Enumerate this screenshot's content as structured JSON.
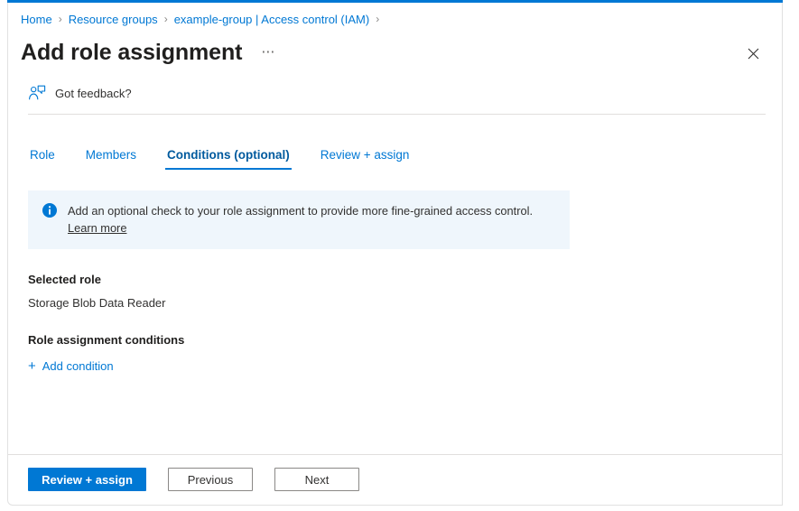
{
  "breadcrumb": {
    "items": [
      {
        "label": "Home"
      },
      {
        "label": "Resource groups"
      },
      {
        "label": "example-group | Access control (IAM)"
      }
    ],
    "separator": "›"
  },
  "header": {
    "title": "Add role assignment",
    "ellipsis": "⋯",
    "close_label": "Close"
  },
  "feedback": {
    "label": "Got feedback?",
    "icon": "person-feedback-icon"
  },
  "tabs": [
    {
      "label": "Role",
      "active": false
    },
    {
      "label": "Members",
      "active": false
    },
    {
      "label": "Conditions (optional)",
      "active": true
    },
    {
      "label": "Review + assign",
      "active": false
    }
  ],
  "info_bar": {
    "icon": "info-circle-icon",
    "text": "Add an optional check to your role assignment to provide more fine-grained access control. ",
    "link_text": "Learn more"
  },
  "sections": {
    "selected_role_heading": "Selected role",
    "selected_role_value": "Storage Blob Data Reader",
    "conditions_heading": "Role assignment conditions",
    "add_condition_label": "Add condition",
    "add_condition_plus": "+"
  },
  "footer": {
    "review_assign_label": "Review + assign",
    "previous_label": "Previous",
    "next_label": "Next"
  },
  "colors": {
    "accent": "#0078d4",
    "link": "#0078d4",
    "active_tab": "#005a9e",
    "info_bar_bg": "#eff6fc",
    "divider": "#e1dfdd",
    "text": "#323130"
  }
}
